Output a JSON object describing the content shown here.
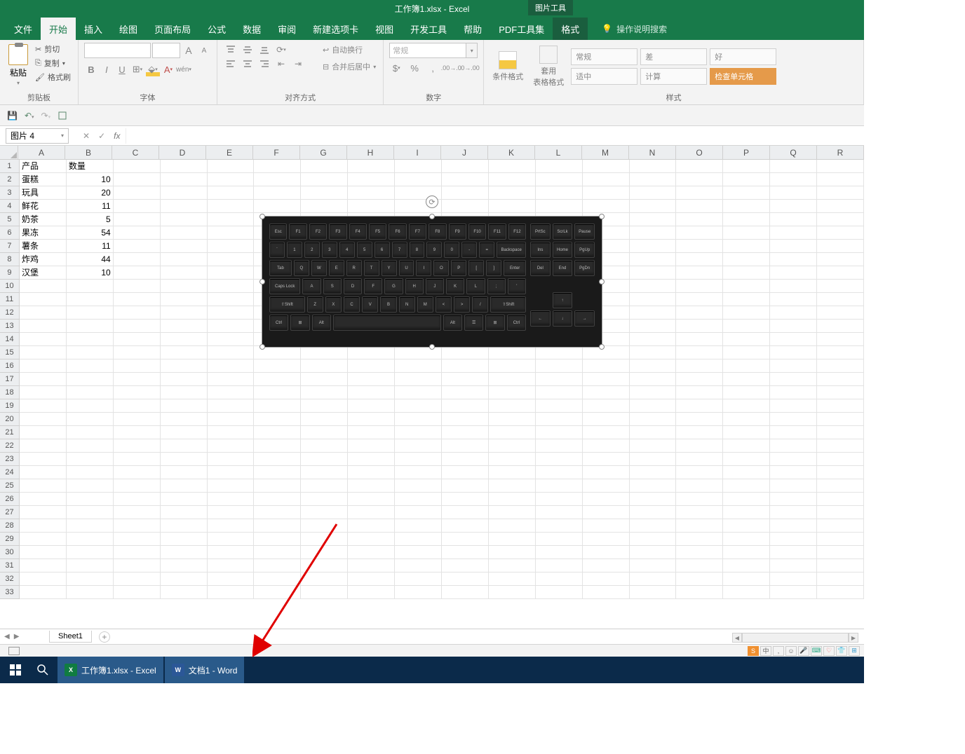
{
  "title": "工作簿1.xlsx - Excel",
  "context_tool": "图片工具",
  "tabs": [
    "文件",
    "开始",
    "插入",
    "绘图",
    "页面布局",
    "公式",
    "数据",
    "审阅",
    "新建选项卡",
    "视图",
    "开发工具",
    "帮助",
    "PDF工具集"
  ],
  "active_tab": "开始",
  "context_tab": "格式",
  "tell_me": "操作说明搜索",
  "ribbon": {
    "clipboard": {
      "label": "剪贴板",
      "paste": "粘贴",
      "cut": "剪切",
      "copy": "复制",
      "format_painter": "格式刷"
    },
    "font": {
      "label": "字体",
      "bold": "B",
      "italic": "I",
      "underline": "U",
      "size_up": "A",
      "size_down": "A"
    },
    "alignment": {
      "label": "对齐方式",
      "wrap": "自动换行",
      "merge": "合并后居中"
    },
    "number": {
      "label": "数字",
      "general": "常规"
    },
    "styles": {
      "label": "样式",
      "cond": "条件格式",
      "cellstyle": "套用\n表格格式",
      "gallery": [
        "常规",
        "差",
        "好",
        "适中",
        "计算",
        "检查单元格"
      ]
    }
  },
  "name_box": "图片 4",
  "fx_label": "fx",
  "columns": [
    "A",
    "B",
    "C",
    "D",
    "E",
    "F",
    "G",
    "H",
    "I",
    "J",
    "K",
    "L",
    "M",
    "N",
    "O",
    "P",
    "Q",
    "R"
  ],
  "data": {
    "headers": [
      "产品",
      "数量"
    ],
    "rows": [
      [
        "蛋糕",
        "10"
      ],
      [
        "玩具",
        "20"
      ],
      [
        "鲜花",
        "11"
      ],
      [
        "奶茶",
        "5"
      ],
      [
        "果冻",
        "54"
      ],
      [
        "薯条",
        "11"
      ],
      [
        "炸鸡",
        "44"
      ],
      [
        "汉堡",
        "10"
      ]
    ]
  },
  "row_count": 33,
  "sheet": {
    "name": "Sheet1"
  },
  "taskbar": {
    "excel": "工作簿1.xlsx - Excel",
    "word": "文档1 - Word"
  },
  "keyboard_rows": [
    [
      "Esc",
      "F1",
      "F2",
      "F3",
      "F4",
      "F5",
      "F6",
      "F7",
      "F8",
      "F9",
      "F10",
      "F11",
      "F12"
    ],
    [
      "`",
      "1",
      "2",
      "3",
      "4",
      "5",
      "6",
      "7",
      "8",
      "9",
      "0",
      "-",
      "=",
      "Backspace"
    ],
    [
      "Tab",
      "Q",
      "W",
      "E",
      "R",
      "T",
      "Y",
      "U",
      "I",
      "O",
      "P",
      "[",
      "]",
      "Enter"
    ],
    [
      "Caps Lock",
      "A",
      "S",
      "D",
      "F",
      "G",
      "H",
      "J",
      "K",
      "L",
      ";",
      "'"
    ],
    [
      "⇧Shift",
      "Z",
      "X",
      "C",
      "V",
      "B",
      "N",
      "M",
      "<",
      ">",
      "/",
      "⇧Shift"
    ],
    [
      "Ctrl",
      "⊞",
      "Alt",
      "",
      "Alt",
      "☰",
      "⊞",
      "Ctrl"
    ]
  ],
  "keyboard_side": [
    [
      "PrtSc",
      "ScrLk",
      "Pause"
    ],
    [
      "Ins",
      "Home",
      "PgUp"
    ],
    [
      "Del",
      "End",
      "PgDn"
    ],
    [
      "",
      "↑",
      ""
    ],
    [
      "←",
      "↓",
      "→"
    ]
  ]
}
